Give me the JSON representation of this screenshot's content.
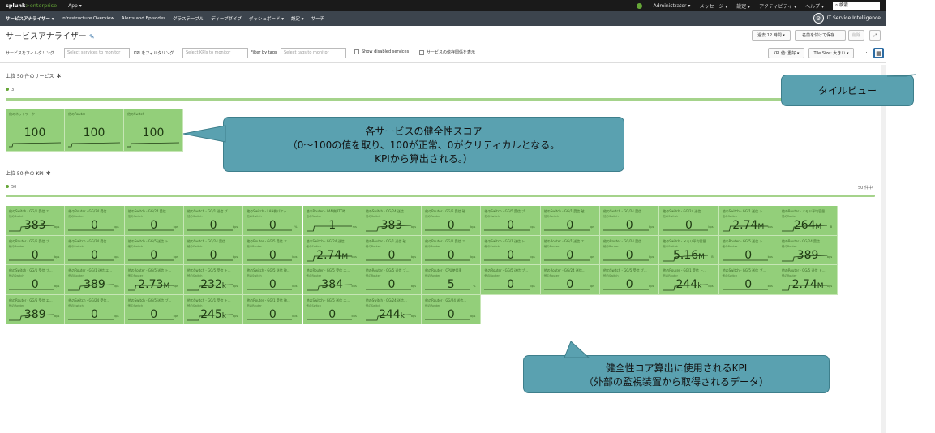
{
  "topbar": {
    "logo_main": "splunk",
    "logo_ent": ">enterprise",
    "app_menu": "App ▾",
    "admin_menu": "Administrator ▾",
    "messages_menu": "メッセージ ▾",
    "settings_menu": "設定 ▾",
    "activity_menu": "アクティビティ ▾",
    "help_menu": "ヘルプ ▾",
    "search_placeholder": "検索"
  },
  "navbar": {
    "items": [
      "サービスアナライザー ▾",
      "Infrastructure Overview",
      "Alerts and Episodes",
      "グラステーブル",
      "ディープダイブ",
      "ダッシュボード ▾",
      "設定 ▾",
      "サーチ"
    ],
    "itsi_label": "IT Service Intelligence"
  },
  "header": {
    "title": "サービスアナライザー",
    "time_button": "過去 12 時間 ▾",
    "save_button": "名前を付けて保存...",
    "delete_button": "削除"
  },
  "filters": {
    "service_label": "サービスをフィルタリング",
    "service_placeholder": "Select services to monitor",
    "kpi_label": "KPI をフィルタリング",
    "kpi_placeholder": "Select KPIs to monitor",
    "tags_label": "Filter by tags",
    "tags_placeholder": "Select tags to monitor",
    "show_disabled": "Show disabled services",
    "show_deps": "サービスの依存関係を表示",
    "kpi_sort": "KPI 値: 重好 ▾",
    "tile_size": "Tile Size: 大きい ▾"
  },
  "services_section": {
    "title": "上位 50 件のサービス",
    "count": "3",
    "tiles": [
      {
        "name": "他のネットワーク",
        "value": "100"
      },
      {
        "name": "他のRouter",
        "value": "100"
      },
      {
        "name": "他のSwitch",
        "value": "100"
      }
    ]
  },
  "kpi_section": {
    "title": "上位 50 件の KPI",
    "count": "50",
    "count_right": "50 件中",
    "tiles": [
      {
        "name": "他のSwitch - GG/1 受信 エ...",
        "sub": "他のSwitch",
        "value": "383",
        "unit": "",
        "ru": "bps",
        "spark": "rise"
      },
      {
        "name": "他のRouter - GG/24 受信...",
        "sub": "他のRouter",
        "value": "0",
        "unit": "",
        "ru": "bps",
        "spark": "flat"
      },
      {
        "name": "他のSwitch - GG/24 受信...",
        "sub": "他のSwitch",
        "value": "0",
        "unit": "",
        "ru": "bps",
        "spark": "flat"
      },
      {
        "name": "他のSwitch - GG/1 送信 ブ...",
        "sub": "他のSwitch",
        "value": "0",
        "unit": "",
        "ru": "bps",
        "spark": "flat"
      },
      {
        "name": "他のSwitch - LAN側パケッ...",
        "sub": "他のSwitch",
        "value": "0",
        "unit": "",
        "ru": "%",
        "spark": "flat"
      },
      {
        "name": "他のRouter - LAN側RTT時",
        "sub": "他のRouter",
        "value": "1",
        "unit": "",
        "ru": "ms",
        "spark": "step"
      },
      {
        "name": "他のSwitch - GG/24 送信...",
        "sub": "他のSwitch",
        "value": "383",
        "unit": "",
        "ru": "bps",
        "spark": "rise"
      },
      {
        "name": "他のRouter - GG/5 受信 破...",
        "sub": "他のRouter",
        "value": "0",
        "unit": "",
        "ru": "bps",
        "spark": "flat"
      },
      {
        "name": "他のSwitch - GG/5 受信 ブ...",
        "sub": "他のSwitch",
        "value": "0",
        "unit": "",
        "ru": "bps",
        "spark": "flat"
      },
      {
        "name": "他のSwitch - GG/1 受信 破...",
        "sub": "他のSwitch",
        "value": "0",
        "unit": "",
        "ru": "bps",
        "spark": "flat"
      },
      {
        "name": "他のSwitch - GG/24 受信...",
        "sub": "他のSwitch",
        "value": "0",
        "unit": "",
        "ru": "bps",
        "spark": "flat"
      },
      {
        "name": "他のSwitch - GG/24 送信...",
        "sub": "他のSwitch",
        "value": "0",
        "unit": "",
        "ru": "bps",
        "spark": "flat"
      },
      {
        "name": "他のSwitch - GG/1 送信 ト...",
        "sub": "他のSwitch",
        "value": "2.74",
        "unit": "M",
        "ru": "bps",
        "spark": "step"
      },
      {
        "name": "他のRouter - メモリ平均容量",
        "sub": "他のRouter",
        "value": "264",
        "unit": "M",
        "ru": "B",
        "spark": "rise"
      },
      {
        "name": "他のRouter - GG/5 受信 ブ...",
        "sub": "他のRouter",
        "value": "0",
        "unit": "",
        "ru": "bps",
        "spark": "flat"
      },
      {
        "name": "他のSwitch - GG/24 受信...",
        "sub": "他のSwitch",
        "value": "0",
        "unit": "",
        "ru": "bps",
        "spark": "flat"
      },
      {
        "name": "他のSwitch - GG/5 送信 ト...",
        "sub": "他のSwitch",
        "value": "0",
        "unit": "",
        "ru": "bps",
        "spark": "flat"
      },
      {
        "name": "他のSwitch - GG/24 受信...",
        "sub": "他のSwitch",
        "value": "0",
        "unit": "",
        "ru": "bps",
        "spark": "flat"
      },
      {
        "name": "他のRouter - GG/5 受信 エ...",
        "sub": "他のRouter",
        "value": "0",
        "unit": "",
        "ru": "bps",
        "spark": "flat"
      },
      {
        "name": "他のSwitch - GG/24 送信...",
        "sub": "他のSwitch",
        "value": "2.74",
        "unit": "M",
        "ru": "bps",
        "spark": "step"
      },
      {
        "name": "他のRouter - GG/1 送信 破...",
        "sub": "他のRouter",
        "value": "0",
        "unit": "",
        "ru": "bps",
        "spark": "flat"
      },
      {
        "name": "他のRouter - GG/1 受信 エ...",
        "sub": "他のRouter",
        "value": "0",
        "unit": "",
        "ru": "bps",
        "spark": "flat"
      },
      {
        "name": "他のSwitch - GG/1 送信 ト...",
        "sub": "他のSwitch",
        "value": "0",
        "unit": "",
        "ru": "bps",
        "spark": "flat"
      },
      {
        "name": "他のRouter - GG/1 送信 エ...",
        "sub": "他のRouter",
        "value": "0",
        "unit": "",
        "ru": "bps",
        "spark": "flat"
      },
      {
        "name": "他のRouter - GG/24 受信...",
        "sub": "他のRouter",
        "value": "0",
        "unit": "",
        "ru": "bps",
        "spark": "flat"
      },
      {
        "name": "他のSwitch - メモリ平均容量",
        "sub": "他のSwitch",
        "value": "5.16",
        "unit": "M",
        "ru": "B",
        "spark": "rise"
      },
      {
        "name": "他のRouter - GG/5 送信 ト...",
        "sub": "他のRouter",
        "value": "0",
        "unit": "",
        "ru": "bps",
        "spark": "flat"
      },
      {
        "name": "他のRouter - GG/24 受信...",
        "sub": "他のRouter",
        "value": "389",
        "unit": "",
        "ru": "bps",
        "spark": "rise"
      },
      {
        "name": "他のSwitch - GG/1 受信 ブ...",
        "sub": "他のSwitch",
        "value": "0",
        "unit": "",
        "ru": "bps",
        "spark": "flat"
      },
      {
        "name": "他のRouter - GG/1 送信 エ...",
        "sub": "他のRouter",
        "value": "389",
        "unit": "",
        "ru": "bps",
        "spark": "rise"
      },
      {
        "name": "他のRouter - GG/5 送信 ト...",
        "sub": "他のRouter",
        "value": "2.73",
        "unit": "M",
        "ru": "bps",
        "spark": "step"
      },
      {
        "name": "他のSwitch - GG/5 受信 ト...",
        "sub": "他のSwitch",
        "value": "232",
        "unit": "k",
        "ru": "bps",
        "spark": "rise"
      },
      {
        "name": "他のSwitch - GG/5 送信 破...",
        "sub": "他のSwitch",
        "value": "0",
        "unit": "",
        "ru": "bps",
        "spark": "flat"
      },
      {
        "name": "他のRouter - GG/5 受信 エ...",
        "sub": "他のRouter",
        "value": "384",
        "unit": "",
        "ru": "bps",
        "spark": "rise"
      },
      {
        "name": "他のRouter - GG/5 送信 ブ...",
        "sub": "他のRouter",
        "value": "0",
        "unit": "",
        "ru": "bps",
        "spark": "flat"
      },
      {
        "name": "他のRouter - CPU使用率",
        "sub": "他のRouter",
        "value": "5",
        "unit": "",
        "ru": "%",
        "spark": "flat"
      },
      {
        "name": "他のRouter - GG/5 送信 ブ...",
        "sub": "他のRouter",
        "value": "0",
        "unit": "",
        "ru": "bps",
        "spark": "flat"
      },
      {
        "name": "他のRouter - GG/24 送信...",
        "sub": "他のRouter",
        "value": "0",
        "unit": "",
        "ru": "bps",
        "spark": "flat"
      },
      {
        "name": "他のSwitch - GG/5 受信 ブ...",
        "sub": "他のSwitch",
        "value": "0",
        "unit": "",
        "ru": "bps",
        "spark": "flat"
      },
      {
        "name": "他のRouter - GG/1 受信 ト...",
        "sub": "他のRouter",
        "value": "244",
        "unit": "k",
        "ru": "bps",
        "spark": "rise"
      },
      {
        "name": "他のSwitch - GG/5 送信 ブ...",
        "sub": "他のSwitch",
        "value": "0",
        "unit": "",
        "ru": "bps",
        "spark": "flat"
      },
      {
        "name": "他のRouter - GG/5 送信 ト...",
        "sub": "他のRouter",
        "value": "2.74",
        "unit": "M",
        "ru": "bps",
        "spark": "step"
      },
      {
        "name": "他のRouter - GG/5 受信 エ...",
        "sub": "他のRouter",
        "value": "389",
        "unit": "",
        "ru": "bps",
        "spark": "rise"
      },
      {
        "name": "他のSwitch - GG/24 受信...",
        "sub": "他のSwitch",
        "value": "0",
        "unit": "",
        "ru": "bps",
        "spark": "flat"
      },
      {
        "name": "他のSwitch - GG/5 送信 ブ...",
        "sub": "他のSwitch",
        "value": "0",
        "unit": "",
        "ru": "bps",
        "spark": "flat"
      },
      {
        "name": "他のSwitch - GG/1 受信 ト...",
        "sub": "他のSwitch",
        "value": "245",
        "unit": "k",
        "ru": "bps",
        "spark": "rise"
      },
      {
        "name": "他のRouter - GG/1 受信 破...",
        "sub": "他のRouter",
        "value": "0",
        "unit": "",
        "ru": "bps",
        "spark": "flat"
      },
      {
        "name": "他のSwitch - GG/5 送信 エ...",
        "sub": "他のSwitch",
        "value": "0",
        "unit": "",
        "ru": "bps",
        "spark": "flat"
      },
      {
        "name": "他のSwitch - GG/24 送信...",
        "sub": "他のSwitch",
        "value": "244",
        "unit": "k",
        "ru": "bps",
        "spark": "rise"
      },
      {
        "name": "他のRouter - GG/24 送信...",
        "sub": "他のRouter",
        "value": "0",
        "unit": "",
        "ru": "bps",
        "spark": "flat"
      }
    ]
  },
  "callouts": {
    "tile_view": "タイルビュー",
    "health_score_line1": "各サービスの健全性スコア",
    "health_score_line2": "（0～100の値を取り、100が正常、0がクリティカルとなる。",
    "health_score_line3": "KPIから算出される。）",
    "kpi_line1": "健全性コア算出に使用されるKPI",
    "kpi_line2": "（外部の監視装置から取得されるデータ）"
  },
  "colors": {
    "tile_ok": "#93cf7a",
    "callout": "#5aa1b0",
    "nav_bg": "#3c444d",
    "top_bg": "#1a1a1a"
  }
}
